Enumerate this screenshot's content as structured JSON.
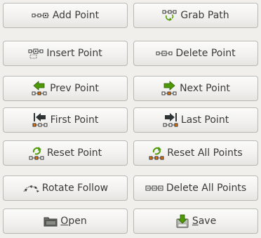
{
  "buttons": {
    "add_point": {
      "label": "Add Point",
      "icon": "add-point-icon"
    },
    "grab_path": {
      "label": "Grab Path",
      "icon": "grab-path-icon"
    },
    "insert_point": {
      "label": "Insert Point",
      "icon": "insert-point-icon"
    },
    "delete_point": {
      "label": "Delete Point",
      "icon": "delete-point-icon"
    },
    "prev_point": {
      "label": "Prev Point",
      "icon": "prev-point-icon"
    },
    "next_point": {
      "label": "Next Point",
      "icon": "next-point-icon"
    },
    "first_point": {
      "label": "First Point",
      "icon": "first-point-icon"
    },
    "last_point": {
      "label": "Last Point",
      "icon": "last-point-icon"
    },
    "reset_point": {
      "label": "Reset Point",
      "icon": "reset-point-icon"
    },
    "reset_all_points": {
      "label": "Reset All Points",
      "icon": "reset-all-points-icon"
    },
    "rotate_follow": {
      "label": "Rotate Follow",
      "icon": "rotate-follow-icon"
    },
    "delete_all_points": {
      "label": "Delete All Points",
      "icon": "delete-all-points-icon"
    },
    "open": {
      "mnemonic": "O",
      "rest": "pen",
      "icon": "folder-open-icon"
    },
    "save": {
      "mnemonic": "S",
      "rest": "ave",
      "icon": "save-icon"
    }
  },
  "colors": {
    "arrow_green": "#4e9a06",
    "arrow_dark": "#2e3436",
    "point_orange": "#f57900",
    "folder": "#555753"
  }
}
